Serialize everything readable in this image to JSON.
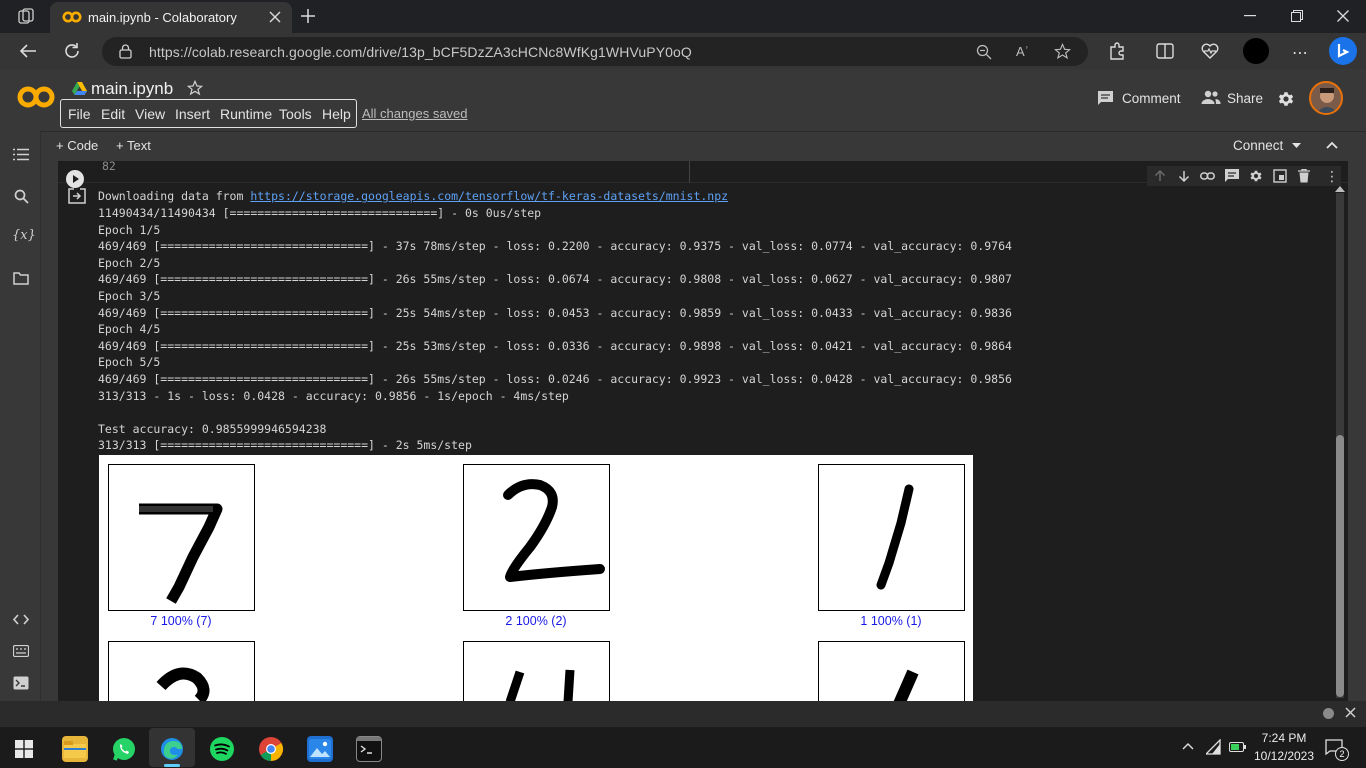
{
  "browser": {
    "tab_title": "main.ipynb - Colaboratory",
    "url": "https://colab.research.google.com/drive/13p_bCF5DzZA3cHCNc8WfKg1WHVuPY0oQ"
  },
  "colab": {
    "notebook_name": "main.ipynb",
    "menu": [
      "File",
      "Edit",
      "View",
      "Insert",
      "Runtime",
      "Tools",
      "Help"
    ],
    "save_status": "All changes saved",
    "comment_label": "Comment",
    "share_label": "Share",
    "add_code_label": "+ Code",
    "add_text_label": "+ Text",
    "connect_label": "Connect"
  },
  "cell": {
    "source_tail": "82",
    "output_lines": [
      {
        "pre": "Downloading data from ",
        "link": "https://storage.googleapis.com/tensorflow/tf-keras-datasets/mnist.npz"
      },
      {
        "text": "11490434/11490434 [==============================] - 0s 0us/step"
      },
      {
        "text": "Epoch 1/5"
      },
      {
        "text": "469/469 [==============================] - 37s 78ms/step - loss: 0.2200 - accuracy: 0.9375 - val_loss: 0.0774 - val_accuracy: 0.9764"
      },
      {
        "text": "Epoch 2/5"
      },
      {
        "text": "469/469 [==============================] - 26s 55ms/step - loss: 0.0674 - accuracy: 0.9808 - val_loss: 0.0627 - val_accuracy: 0.9807"
      },
      {
        "text": "Epoch 3/5"
      },
      {
        "text": "469/469 [==============================] - 25s 54ms/step - loss: 0.0453 - accuracy: 0.9859 - val_loss: 0.0433 - val_accuracy: 0.9836"
      },
      {
        "text": "Epoch 4/5"
      },
      {
        "text": "469/469 [==============================] - 25s 53ms/step - loss: 0.0336 - accuracy: 0.9898 - val_loss: 0.0421 - val_accuracy: 0.9864"
      },
      {
        "text": "Epoch 5/5"
      },
      {
        "text": "469/469 [==============================] - 26s 55ms/step - loss: 0.0246 - accuracy: 0.9923 - val_loss: 0.0428 - val_accuracy: 0.9856"
      },
      {
        "text": "313/313 - 1s - loss: 0.0428 - accuracy: 0.9856 - 1s/epoch - 4ms/step"
      },
      {
        "text": ""
      },
      {
        "text": "Test accuracy: 0.9855999946594238"
      },
      {
        "text": "313/313 [==============================] - 2s 5ms/step"
      }
    ],
    "predictions": [
      {
        "caption": "7 100% (7)",
        "digit": "7"
      },
      {
        "caption": "2 100% (2)",
        "digit": "2"
      },
      {
        "caption": "1 100% (1)",
        "digit": "1"
      }
    ]
  },
  "taskbar": {
    "time": "7:24 PM",
    "date": "10/12/2023",
    "notification_count": "2"
  },
  "colors": {
    "accent_orange": "#f9ab00",
    "link": "#5ea1f5",
    "caption_blue": "#1a1ae6"
  }
}
